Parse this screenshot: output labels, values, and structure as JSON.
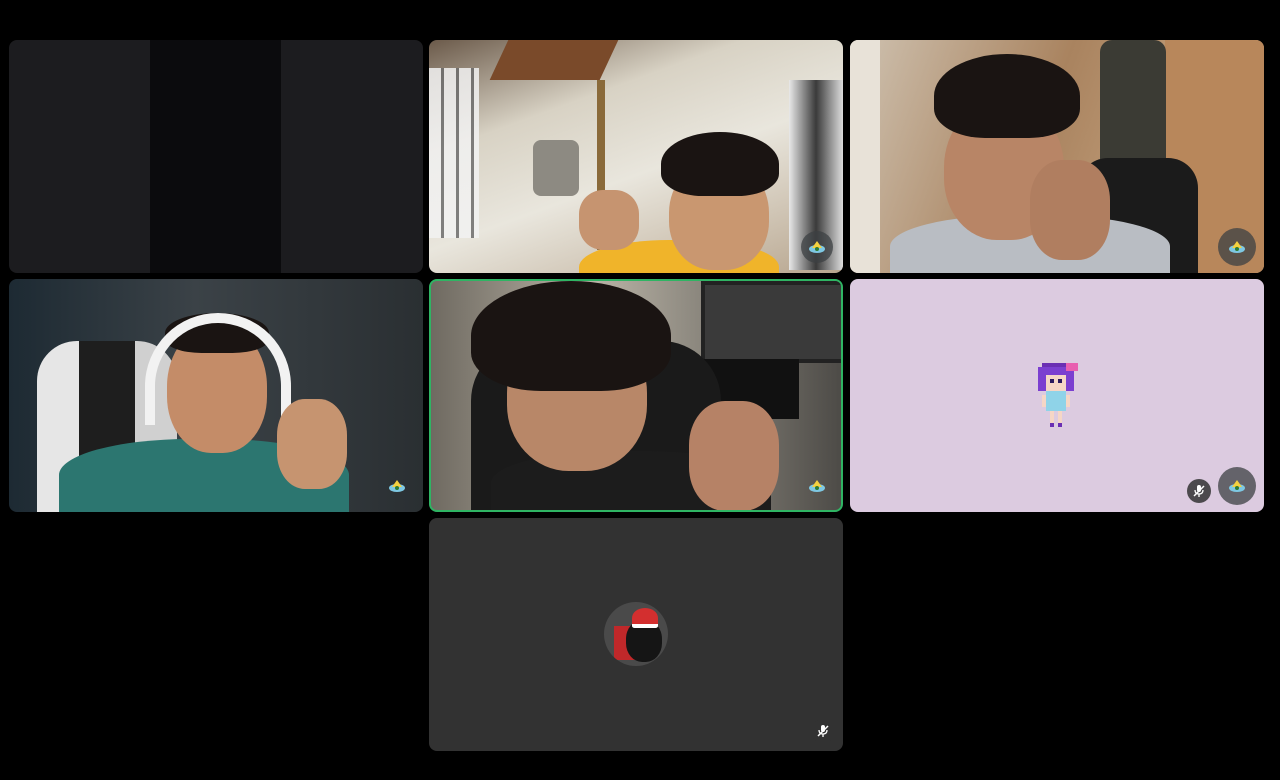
{
  "meeting": {
    "participants": [
      {
        "id": "p1",
        "camera": "on",
        "dark_feed": true
      },
      {
        "id": "p2",
        "camera": "on",
        "icon": "audio-level-icon"
      },
      {
        "id": "p3",
        "camera": "on",
        "icon": "audio-level-icon"
      },
      {
        "id": "p4",
        "camera": "on",
        "icon": "audio-level-icon"
      },
      {
        "id": "p5",
        "camera": "on",
        "speaking": true,
        "icon": "audio-level-icon"
      },
      {
        "id": "p6",
        "camera": "off",
        "muted": true,
        "avatar": "pixel-character",
        "icon": "audio-level-icon"
      },
      {
        "id": "p7",
        "camera": "off",
        "muted": true,
        "avatar": "cat-santa-hat"
      }
    ],
    "colors": {
      "page_background": "#000000",
      "tile_dark": "#1c1c1f",
      "tile_off": "#323232",
      "tile_lavender": "#dccbe0",
      "active_speaker_border": "#2fb463"
    }
  }
}
